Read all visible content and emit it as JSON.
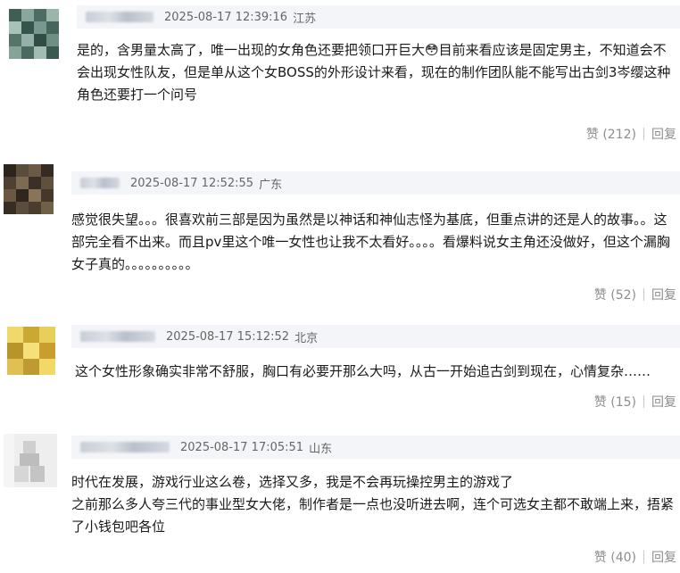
{
  "comments": [
    {
      "timestamp": "2025-08-17 12:39:16",
      "location": "江苏",
      "content": "是的，含男量太高了，唯一出现的女角色还要把领口开巨大😳目前来看应该是固定男主，不知道会不会出现女性队友，但是单从这个女BOSS的外形设计来看，现在的制作团队能不能写出古剑3岑缨这种角色还要打一个问号",
      "like_label": "赞 (212)",
      "reply_label": "回复"
    },
    {
      "timestamp": "2025-08-17 12:52:55",
      "location": "广东",
      "content": "感觉很失望。。。很喜欢前三部是因为虽然是以神话和神仙志怪为基底，但重点讲的还是人的故事。。这部完全看不出来。而且pv里这个唯一女性也让我不太看好。。。。看爆料说女主角还没做好，但这个漏胸女子真的。。。。。。。。。。",
      "like_label": "赞 (52)",
      "reply_label": "回复"
    },
    {
      "timestamp": "2025-08-17 15:12:52",
      "location": "北京",
      "content": "这个女性形象确实非常不舒服，胸口有必要开那么大吗，从古一开始追古剑到现在，心情复杂……",
      "like_label": "赞 (15)",
      "reply_label": "回复"
    },
    {
      "timestamp": "2025-08-17 17:05:51",
      "location": "山东",
      "content": "时代在发展，游戏行业这么卷，选择又多，我是不会再玩操控男主的游戏了\n之前那么多人夸三代的事业型女大佬，制作者是一点也没听进去啊，连个可选女主都不敢端上来，捂紧了小钱包吧各位",
      "like_label": "赞 (40)",
      "reply_label": "回复"
    }
  ]
}
